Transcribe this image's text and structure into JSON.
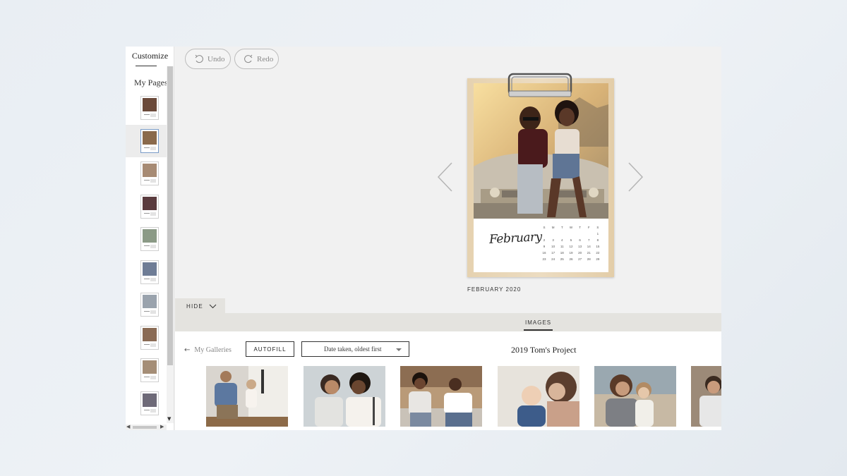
{
  "sidebar": {
    "tab_label": "Customize",
    "section_label": "My Pages",
    "pages": [
      {
        "label": "page-1",
        "color": "#6b4a3a"
      },
      {
        "label": "page-2",
        "color": "#8a6a4c"
      },
      {
        "label": "page-3",
        "color": "#a78b74"
      },
      {
        "label": "page-4",
        "color": "#5a3b3e"
      },
      {
        "label": "page-5",
        "color": "#8b9a86"
      },
      {
        "label": "page-6",
        "color": "#6f7d96"
      },
      {
        "label": "page-7",
        "color": "#9aa3ad"
      },
      {
        "label": "page-8",
        "color": "#8a6b55"
      },
      {
        "label": "page-9",
        "color": "#a58e77"
      },
      {
        "label": "page-10",
        "color": "#6e6a78"
      }
    ]
  },
  "toolbar": {
    "undo_label": "Undo",
    "redo_label": "Redo"
  },
  "preview": {
    "month_script": "February",
    "caption": "FEBRUARY 2020",
    "weekday_headers": [
      "S",
      "M",
      "T",
      "W",
      "T",
      "F",
      "S"
    ],
    "weeks": [
      [
        "",
        "",
        "",
        "",
        "",
        "",
        "1"
      ],
      [
        "2",
        "3",
        "4",
        "5",
        "6",
        "7",
        "8"
      ],
      [
        "9",
        "10",
        "11",
        "12",
        "13",
        "14",
        "15"
      ],
      [
        "16",
        "17",
        "18",
        "19",
        "20",
        "21",
        "22"
      ],
      [
        "23",
        "24",
        "25",
        "26",
        "27",
        "28",
        "29"
      ]
    ]
  },
  "panel": {
    "hide_label": "HIDE",
    "images_tab_label": "IMAGES",
    "galleries_link": "My Galleries",
    "autofill_label": "AUTOFILL",
    "sort_value": "Date taken, oldest first",
    "project_title": "2019 Tom's Project"
  },
  "colors": {
    "app_bg": "#f1f1f1",
    "panel_tab_bg": "#e4e3df",
    "accent_dark": "#333333"
  }
}
